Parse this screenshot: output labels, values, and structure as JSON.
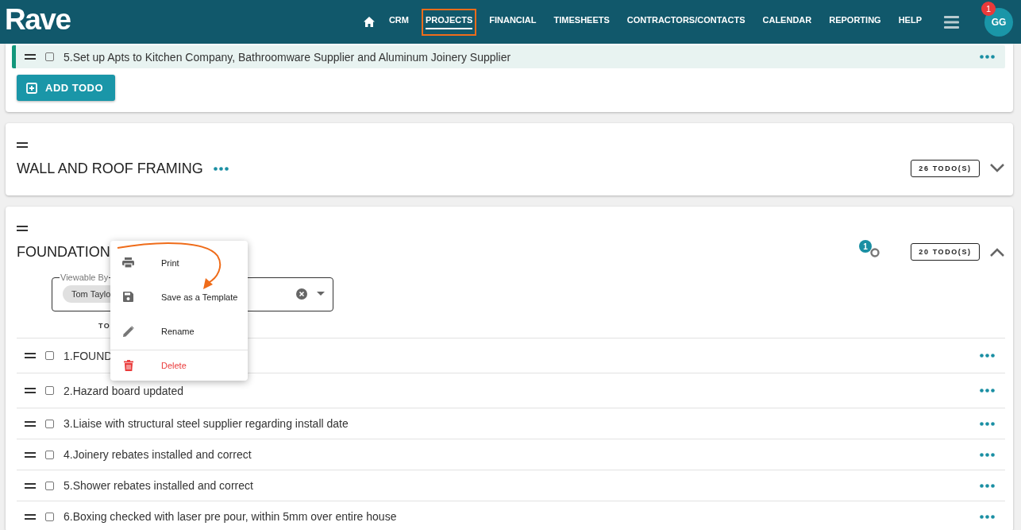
{
  "header": {
    "logo": "Rave",
    "nav": [
      {
        "label": "CRM",
        "selected": false,
        "annotated": false
      },
      {
        "label": "PROJECTS",
        "selected": true,
        "annotated": true
      },
      {
        "label": "FINANCIAL",
        "selected": false,
        "annotated": false
      },
      {
        "label": "TIMESHEETS",
        "selected": false,
        "annotated": false
      },
      {
        "label": "CONTRACTORS/CONTACTS",
        "selected": false,
        "annotated": false
      },
      {
        "label": "CALENDAR",
        "selected": false,
        "annotated": false
      },
      {
        "label": "REPORTING",
        "selected": false,
        "annotated": false
      },
      {
        "label": "HELP",
        "selected": false,
        "annotated": false
      }
    ],
    "notification_count": "1",
    "avatar": "GG"
  },
  "cards": [
    {
      "kind": "partial",
      "add_button": "ADD TODO",
      "rows": [
        {
          "text": "5.Set up Apts to Kitchen Company, Bathroomware Supplier and Aluminum Joinery Supplier",
          "checked": false,
          "highlighted": true
        }
      ]
    },
    {
      "kind": "group",
      "title": "WALL AND ROOF FRAMING",
      "todo_count": "26 TODO(S)",
      "expanded": false
    },
    {
      "kind": "group",
      "title": "FOUNDATION",
      "todo_count": "20 TODO(S)",
      "expanded": true,
      "link_count": "1",
      "viewable_by": {
        "label": "Viewable By",
        "chips": [
          "Tom Taylo"
        ]
      },
      "column_header": "TO",
      "rows": [
        {
          "text": "1.FOUND",
          "checked": false,
          "highlighted": false
        },
        {
          "text": "2.Hazard board updated",
          "checked": false,
          "highlighted": false
        },
        {
          "text": "3.Liaise with structural steel supplier regarding install date",
          "checked": false,
          "highlighted": false
        },
        {
          "text": "4.Joinery rebates installed and correct",
          "checked": false,
          "highlighted": false
        },
        {
          "text": "5.Shower rebates installed and correct",
          "checked": false,
          "highlighted": false
        },
        {
          "text": "6.Boxing checked with laser pre pour, within 5mm over entire house",
          "checked": false,
          "highlighted": false
        }
      ]
    }
  ],
  "context_menu": {
    "items": [
      {
        "label": "Print",
        "kind": "print"
      },
      {
        "label": "Save as a Template",
        "kind": "save"
      },
      {
        "label": "Rename",
        "kind": "rename"
      },
      {
        "label": "Delete",
        "kind": "delete"
      }
    ]
  }
}
